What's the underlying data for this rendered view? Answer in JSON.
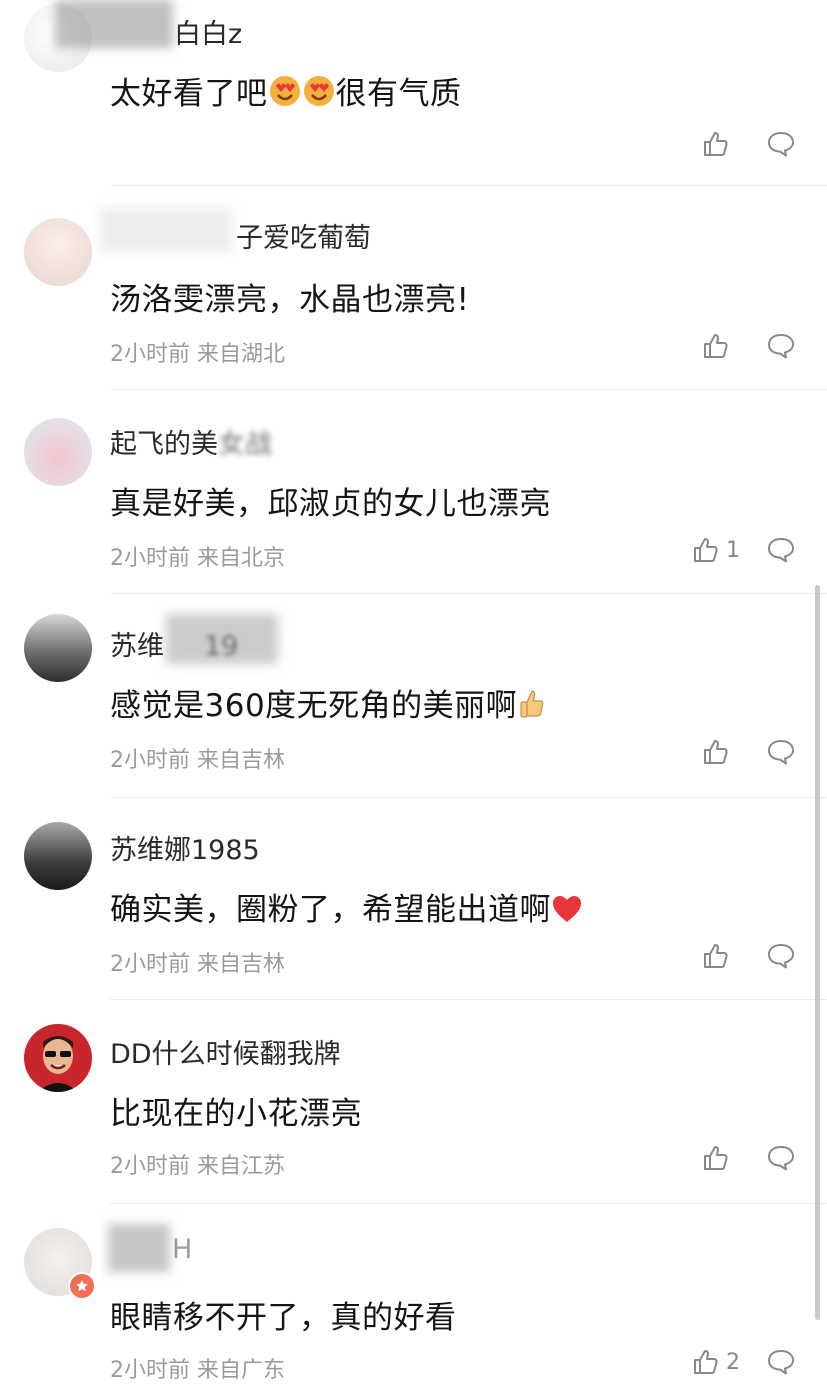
{
  "comments": [
    {
      "username": "白白z",
      "content": "太好看了吧",
      "content_suffix": "很有气质",
      "time": "",
      "location": "",
      "likes": ""
    },
    {
      "username": "子爱吃葡萄",
      "content": "汤洛雯漂亮，水晶也漂亮!",
      "time": "2小时前",
      "location": "来自湖北",
      "likes": ""
    },
    {
      "username": "起飞的美",
      "username_tail": "女战",
      "content": "真是好美，邱淑贞的女儿也漂亮",
      "time": "2小时前",
      "location": "来自北京",
      "likes": "1"
    },
    {
      "username": "苏维",
      "username_tail": "19",
      "content": "感觉是360度无死角的美丽啊",
      "time": "2小时前",
      "location": "来自吉林",
      "likes": ""
    },
    {
      "username": "苏维娜1985",
      "content": "确实美，圈粉了，希望能出道啊",
      "time": "2小时前",
      "location": "来自吉林",
      "likes": ""
    },
    {
      "username": "DD什么时候翻我牌",
      "content": "比现在的小花漂亮",
      "time": "2小时前",
      "location": "来自江苏",
      "likes": ""
    },
    {
      "username": "",
      "username_tail": "H",
      "content": "眼睛移不开了，真的好看",
      "time": "2小时前",
      "location": "来自广东",
      "likes": "2"
    }
  ],
  "icons": {
    "like": "thumbs-up-icon",
    "reply": "comment-bubble-icon",
    "heart_eyes": "heart-eyes-emoji",
    "thumb_emoji": "thumbs-up-emoji",
    "heart_emoji": "red-heart-emoji"
  },
  "colors": {
    "text": "#151515",
    "meta": "#9b9b9b",
    "icon": "#888888",
    "divider": "#ececec",
    "heart": "#e8363a",
    "badge": "#f07054"
  }
}
